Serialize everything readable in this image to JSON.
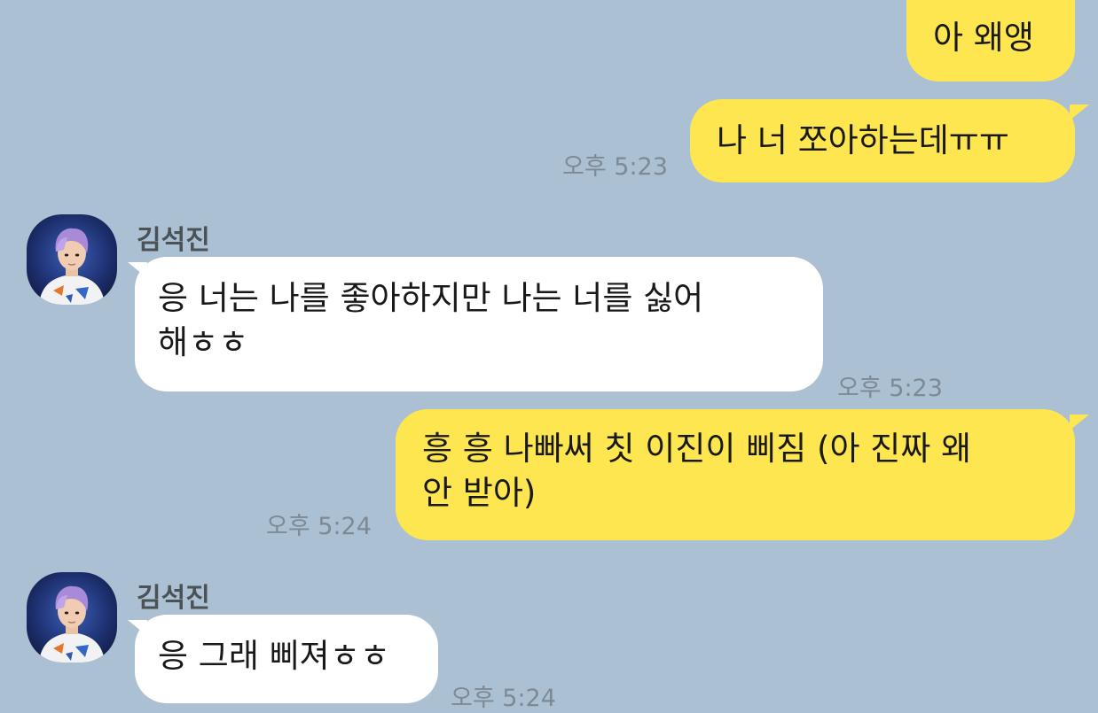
{
  "messages": [
    {
      "from": "me",
      "text": "아 왜앵"
    },
    {
      "from": "me",
      "text": "나 너 쪼아하는데ㅠㅠ",
      "time": "오후 5:23"
    },
    {
      "from": "them",
      "sender": "김석진",
      "text": "응 너는 나를 좋아하지만 나는 너를 싫어\n해ㅎㅎ",
      "time": "오후 5:23"
    },
    {
      "from": "me",
      "text": "흥 흥 나빠써 칫 이진이 삐짐 (아 진짜 왜\n안 받아)",
      "time": "오후 5:24"
    },
    {
      "from": "them",
      "sender": "김석진",
      "text": "응 그래 삐져ㅎㅎ",
      "time": "오후 5:24"
    }
  ],
  "avatar_icon": "profile-photo-purple-hair",
  "colors": {
    "background": "#abc0d2",
    "my_bubble": "#fee650",
    "their_bubble": "#ffffff",
    "timestamp": "#7d8a96",
    "sender_name": "#4b5257"
  }
}
